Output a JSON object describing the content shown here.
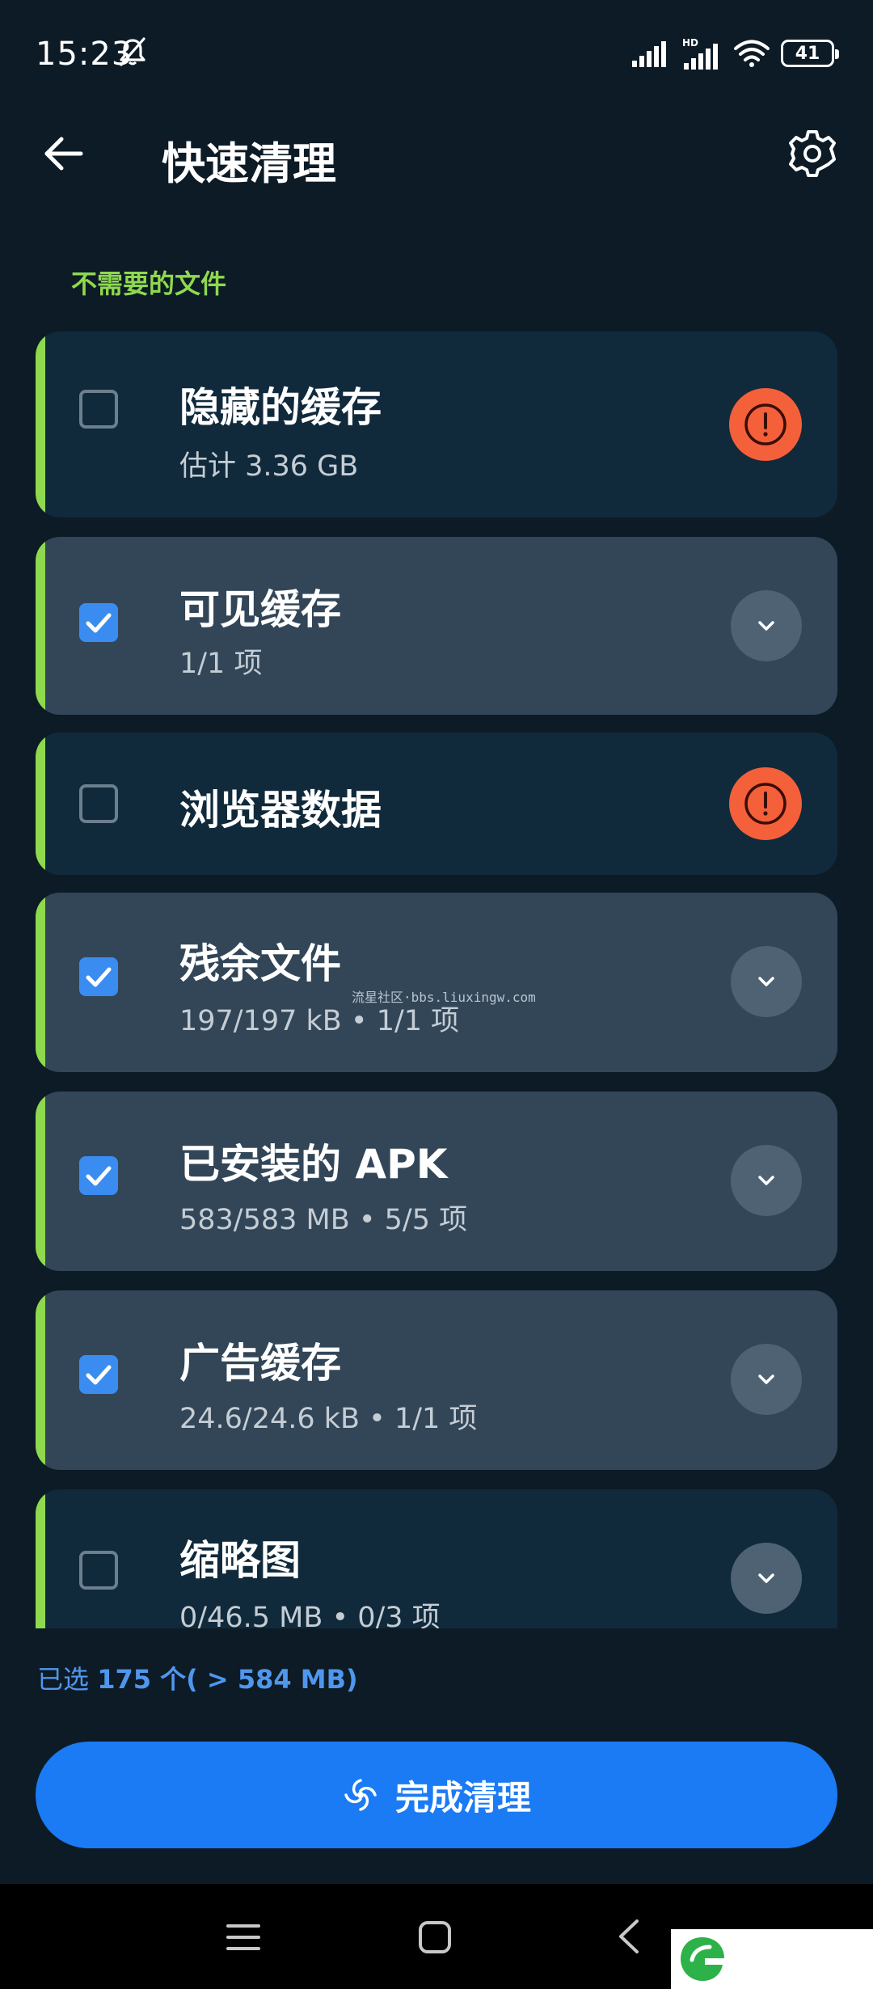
{
  "status_bar": {
    "time": "15:23",
    "battery": "41"
  },
  "header": {
    "title": "快速清理"
  },
  "section": {
    "label": "不需要的文件"
  },
  "items": [
    {
      "title": "隐藏的缓存",
      "subtitle": "估计 3.36 GB",
      "checked": false,
      "action": "warning-icon"
    },
    {
      "title": "可见缓存",
      "subtitle": "1/1 项",
      "checked": true,
      "action": "chevron-down-icon"
    },
    {
      "title": "浏览器数据",
      "subtitle": "",
      "checked": false,
      "action": "warning-icon"
    },
    {
      "title": "残余文件",
      "subtitle": "197/197 kB • 1/1 项",
      "checked": true,
      "action": "chevron-down-icon"
    },
    {
      "title": "已安装的 APK",
      "subtitle": "583/583 MB • 5/5 项",
      "checked": true,
      "action": "chevron-down-icon"
    },
    {
      "title": "广告缓存",
      "subtitle": "24.6/24.6 kB • 1/1 项",
      "checked": true,
      "action": "chevron-down-icon"
    },
    {
      "title": "缩略图",
      "subtitle": "0/46.5 MB • 0/3 项",
      "checked": false,
      "action": "chevron-down-icon"
    }
  ],
  "watermark": "流星社区·bbs.liuxingw.com",
  "summary": {
    "prefix": "已选 ",
    "count": "175",
    "suffix": " 个( > 584 MB)"
  },
  "clean_button": {
    "label": "完成清理"
  },
  "colors": {
    "accent_green": "#8ed94e",
    "primary_blue": "#1b7bf5",
    "warning_red": "#f4603a",
    "background": "#0d1b26"
  }
}
